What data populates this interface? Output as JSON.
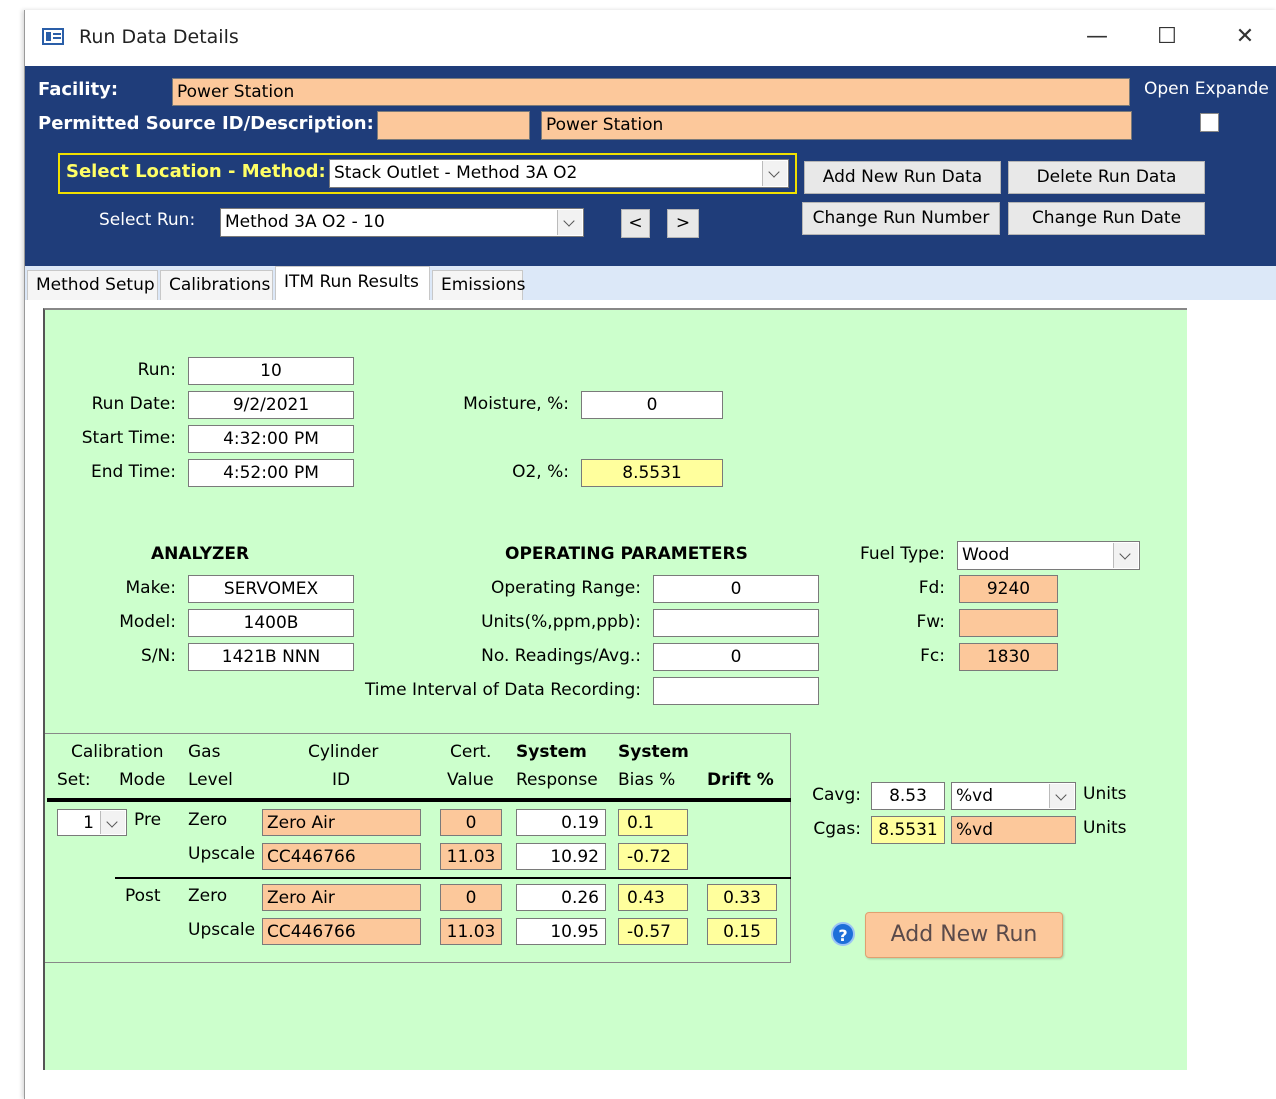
{
  "window": {
    "title": "Run Data Details",
    "minimize": "—",
    "maximize": "☐",
    "close": "✕"
  },
  "header": {
    "facility_label": "Facility:",
    "facility_value": "Power Station",
    "open_expanded_label": "Open Expande",
    "permitted_label": "Permitted Source ID/Description:",
    "permitted_id": "",
    "permitted_desc": "Power Station",
    "select_location_label": "Select Location - Method:",
    "select_location_value": "Stack Outlet - Method 3A O2",
    "select_run_label": "Select Run:",
    "select_run_value": "Method 3A O2 - 10",
    "prev_label": "<",
    "next_label": ">",
    "add_new_run_data": "Add New Run Data",
    "delete_run_data": "Delete Run Data",
    "change_run_number": "Change Run Number",
    "change_run_date": "Change Run Date"
  },
  "tabs": [
    "Method Setup",
    "Calibrations",
    "ITM Run Results",
    "Emissions"
  ],
  "run": {
    "run_label": "Run:",
    "run_value": "10",
    "date_label": "Run Date:",
    "date_value": "9/2/2021",
    "start_label": "Start Time:",
    "start_value": "4:32:00 PM",
    "end_label": "End Time:",
    "end_value": "4:52:00 PM",
    "moisture_label": "Moisture, %:",
    "moisture_value": "0",
    "o2_label": "O2, %:",
    "o2_value": "8.5531"
  },
  "analyzer": {
    "heading": "ANALYZER",
    "make_label": "Make:",
    "make_value": "SERVOMEX",
    "model_label": "Model:",
    "model_value": "1400B",
    "sn_label": "S/N:",
    "sn_value": "1421B NNN"
  },
  "operating": {
    "heading": "OPERATING PARAMETERS",
    "range_label": "Operating Range:",
    "range_value": "0",
    "units_label": "Units(%,ppm,ppb):",
    "units_value": "",
    "readings_label": "No. Readings/Avg.:",
    "readings_value": "0",
    "interval_label": "Time Interval of Data Recording:",
    "interval_value": ""
  },
  "fuel": {
    "type_label": "Fuel Type:",
    "type_value": "Wood",
    "fd_label": "Fd:",
    "fd_value": "9240",
    "fw_label": "Fw:",
    "fw_value": "",
    "fc_label": "Fc:",
    "fc_value": "1830"
  },
  "calibration": {
    "headers": {
      "set_top": "Calibration",
      "set_bottom": "Set:",
      "mode": "Mode",
      "gas_top": "Gas",
      "gas_bottom": "Level",
      "cyl_top": "Cylinder",
      "cyl_bottom": "ID",
      "cert_top": "Cert.",
      "cert_bottom": "Value",
      "resp_top": "System",
      "resp_bottom": "Response",
      "bias_top": "System",
      "bias_bottom": "Bias %",
      "drift": "Drift %"
    },
    "set_value": "1",
    "pre": {
      "mode": "Pre",
      "rows": [
        {
          "level": "Zero",
          "cylinder": "Zero Air",
          "cert": "0",
          "response": "0.19",
          "bias": "0.1",
          "drift": ""
        },
        {
          "level": "Upscale",
          "cylinder": "CC446766",
          "cert": "11.03",
          "response": "10.92",
          "bias": "-0.72",
          "drift": ""
        }
      ]
    },
    "post": {
      "mode": "Post",
      "rows": [
        {
          "level": "Zero",
          "cylinder": "Zero Air",
          "cert": "0",
          "response": "0.26",
          "bias": "0.43",
          "drift": "0.33"
        },
        {
          "level": "Upscale",
          "cylinder": "CC446766",
          "cert": "11.03",
          "response": "10.95",
          "bias": "-0.57",
          "drift": "0.15"
        }
      ]
    }
  },
  "results": {
    "cavg_label": "Cavg:",
    "cavg_value": "8.53",
    "cavg_units": "%vd",
    "units_label": "Units",
    "cgas_label": "Cgas:",
    "cgas_value": "8.5531",
    "cgas_units": "%vd",
    "units_label2": "Units"
  },
  "help_icon": "?",
  "add_new_run": "Add New Run"
}
